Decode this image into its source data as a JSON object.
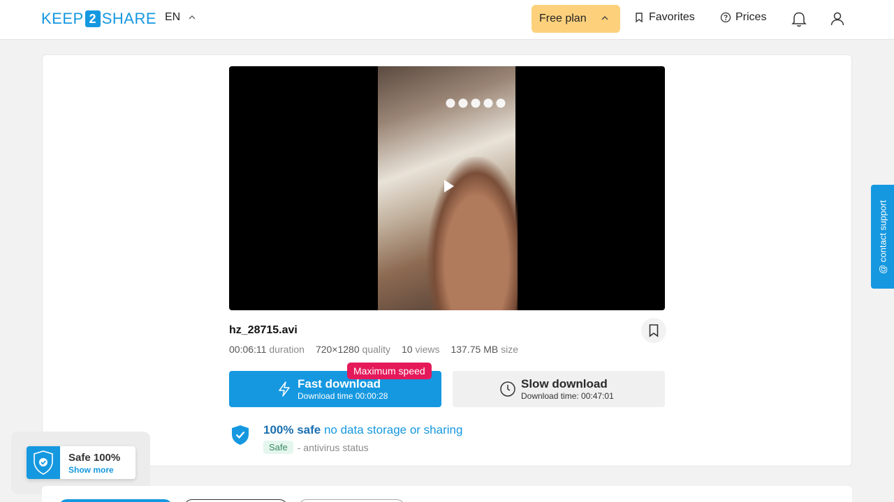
{
  "header": {
    "logo_left": "KEEP",
    "logo_num": "2",
    "logo_right": "SHARE",
    "lang": "EN",
    "plan": "Free plan",
    "favorites": "Favorites",
    "prices": "Prices"
  },
  "file": {
    "name": "hz_28715.avi",
    "duration_value": "00:06:11",
    "duration_label": "duration",
    "quality_value": "720×1280",
    "quality_label": "quality",
    "views_value": "10",
    "views_label": "views",
    "size_value": "137.75 MB",
    "size_label": "size"
  },
  "download": {
    "fast_label": "Fast download",
    "fast_time": "Download time 00:00:28",
    "badge": "Maximum speed",
    "slow_label": "Slow download",
    "slow_time": "Download time: 00:47:01"
  },
  "safety": {
    "strong": "100% safe",
    "rest": "no data storage or sharing",
    "pill": "Safe",
    "status": "- antivirus status"
  },
  "contact": "@ contact support",
  "widget": {
    "title": "Safe 100%",
    "link": "Show more"
  },
  "colors": {
    "accent": "#1598e0",
    "plan": "#fdd17c",
    "badge": "#e5195a"
  }
}
